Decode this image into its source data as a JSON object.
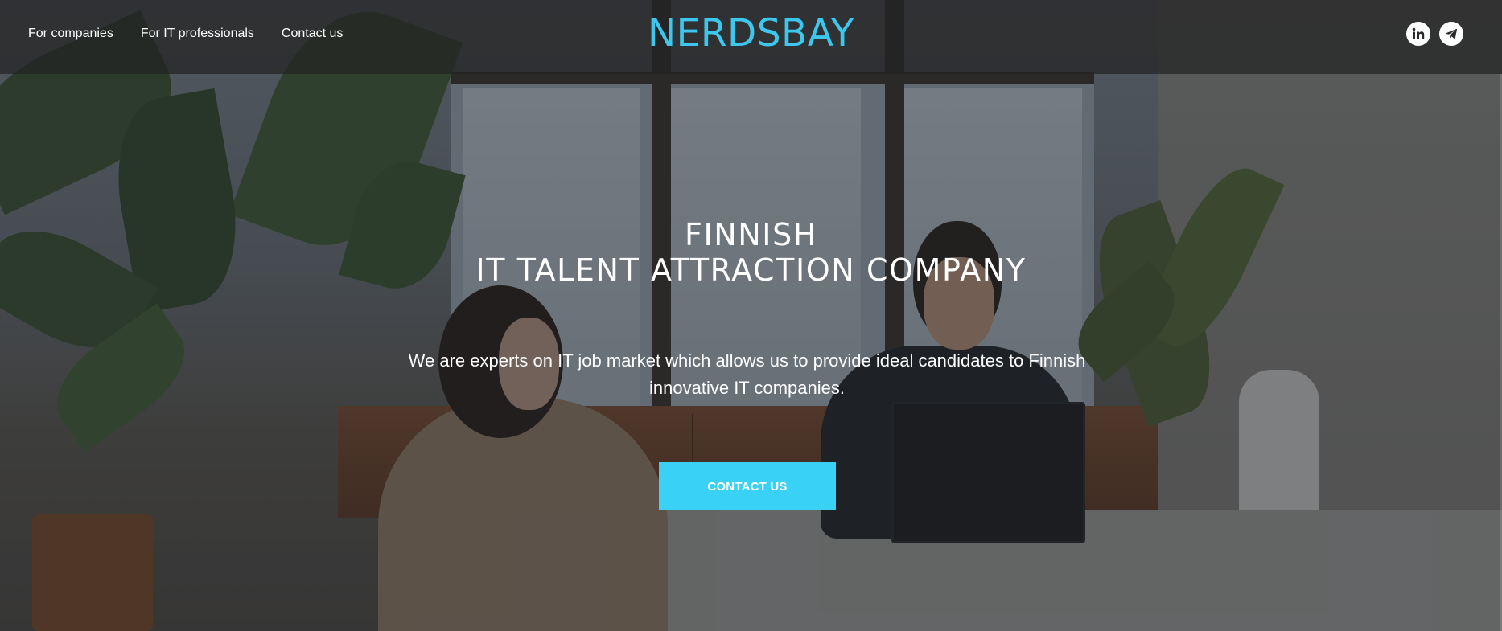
{
  "header": {
    "nav": [
      "For companies",
      "For IT professionals",
      "Contact us"
    ],
    "logo": "NERDSBAY",
    "social": [
      {
        "icon": "linkedin-icon"
      },
      {
        "icon": "telegram-icon"
      }
    ]
  },
  "hero": {
    "title_line1": "FINNISH",
    "title_line2": "IT TALENT ATTRACTION COMPANY",
    "text": "We are experts on IT job market which allows us to provide ideal candidates to Finnish innovative IT companies.",
    "cta": "CONTACT US"
  },
  "colors": {
    "accent": "#39d2f6",
    "logo": "#3dc7ee",
    "header_bg": "#232323"
  }
}
